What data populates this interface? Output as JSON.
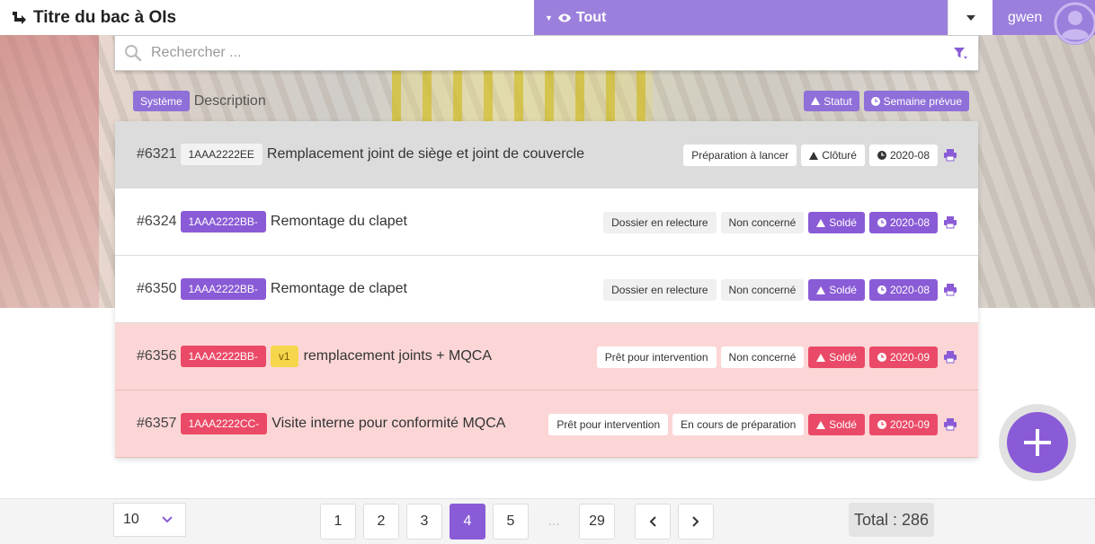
{
  "header": {
    "title": "Titre du bac à OIs",
    "filter_label": "Tout",
    "user_name": "gwen"
  },
  "search": {
    "placeholder": "Rechercher ..."
  },
  "columns": {
    "system": "Système",
    "description": "Description",
    "status": "Statut",
    "week": "Semaine prévue"
  },
  "rows": [
    {
      "id": "#6321",
      "code": "1AAA2222EE",
      "version": "",
      "title": "Remplacement joint de siège et joint de couvercle",
      "tag1": "",
      "tag2": "Préparation à lancer",
      "status": "Clôturé",
      "week": "2020-08"
    },
    {
      "id": "#6324",
      "code": "1AAA2222BB-",
      "version": "",
      "title": "Remontage du clapet",
      "tag1": "Dossier en relecture",
      "tag2": "Non concerné",
      "status": "Soldé",
      "week": "2020-08"
    },
    {
      "id": "#6350",
      "code": "1AAA2222BB-",
      "version": "",
      "title": "Remontage de clapet",
      "tag1": "Dossier en relecture",
      "tag2": "Non concerné",
      "status": "Soldé",
      "week": "2020-08"
    },
    {
      "id": "#6356",
      "code": "1AAA2222BB-",
      "version": "v1",
      "title": "remplacement joints + MQCA",
      "tag1": "Prêt pour intervention",
      "tag2": "Non concerné",
      "status": "Soldé",
      "week": "2020-09"
    },
    {
      "id": "#6357",
      "code": "1AAA2222CC-",
      "version": "",
      "title": "Visite interne pour conformité MQCA",
      "tag1": "Prêt pour intervention",
      "tag2": "En cours de préparation",
      "status": "Soldé",
      "week": "2020-09"
    }
  ],
  "pagination": {
    "page_size": "10",
    "pages": [
      "1",
      "2",
      "3",
      "4",
      "5"
    ],
    "ellipsis": "...",
    "last_page": "29",
    "total": "Total : 286"
  },
  "colors": {
    "accent": "#8a5bd6",
    "header_purple": "#9b7fdc",
    "danger": "#ea4a67",
    "row_pink": "#fcd6d6",
    "row_gray": "#dcdcdc"
  }
}
